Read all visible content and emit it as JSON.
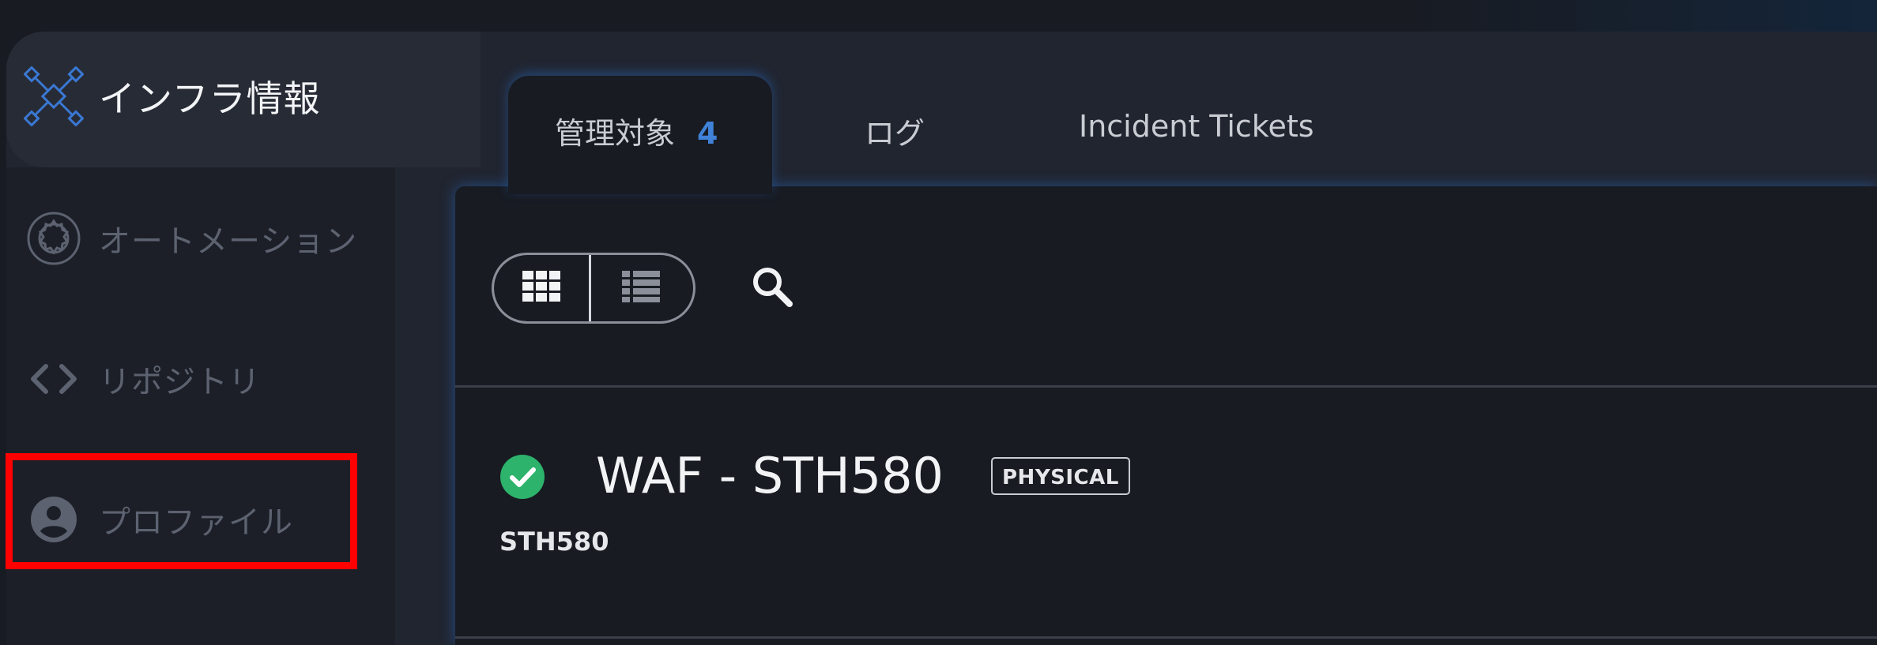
{
  "sidebar": {
    "items": [
      {
        "label": "インフラ情報",
        "icon": "network-icon",
        "active": true
      },
      {
        "label": "オートメーション",
        "icon": "automation-icon",
        "active": false
      },
      {
        "label": "リポジトリ",
        "icon": "code-icon",
        "active": false
      },
      {
        "label": "プロファイル",
        "icon": "account-circle-icon",
        "active": false
      }
    ]
  },
  "tabs": [
    {
      "label": "管理対象",
      "count": "4",
      "active": true
    },
    {
      "label": "ログ",
      "active": false
    },
    {
      "label": "Incident Tickets",
      "active": false
    }
  ],
  "toolbar": {
    "view_modes": [
      "grid-view-icon",
      "list-view-icon"
    ],
    "selected_view": "grid",
    "search_icon": "search-icon"
  },
  "items": [
    {
      "title": "WAF - STH580",
      "badge": "PHYSICAL",
      "subtitle": "STH580",
      "status": "ok",
      "status_color": "#2db36b"
    }
  ],
  "colors": {
    "accent": "#3f82d8",
    "highlight": "#ff0000"
  }
}
